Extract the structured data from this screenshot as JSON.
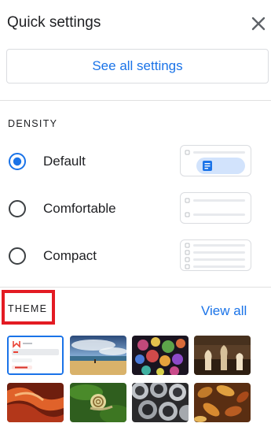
{
  "header": {
    "title": "Quick settings"
  },
  "see_all_settings": "See all settings",
  "density": {
    "label": "DENSITY",
    "options": [
      {
        "label": "Default",
        "selected": true
      },
      {
        "label": "Comfortable",
        "selected": false
      },
      {
        "label": "Compact",
        "selected": false
      }
    ]
  },
  "theme": {
    "label": "THEME",
    "view_all": "View all",
    "thumbnails": [
      "default-theme",
      "beach-theme",
      "bubbles-theme",
      "chess-theme",
      "canyon-theme",
      "snail-theme",
      "pipes-theme",
      "leaves-theme"
    ]
  },
  "colors": {
    "accent": "#1a73e8",
    "highlight": "#e31b23",
    "text": "#202124",
    "border": "#dadce0"
  }
}
